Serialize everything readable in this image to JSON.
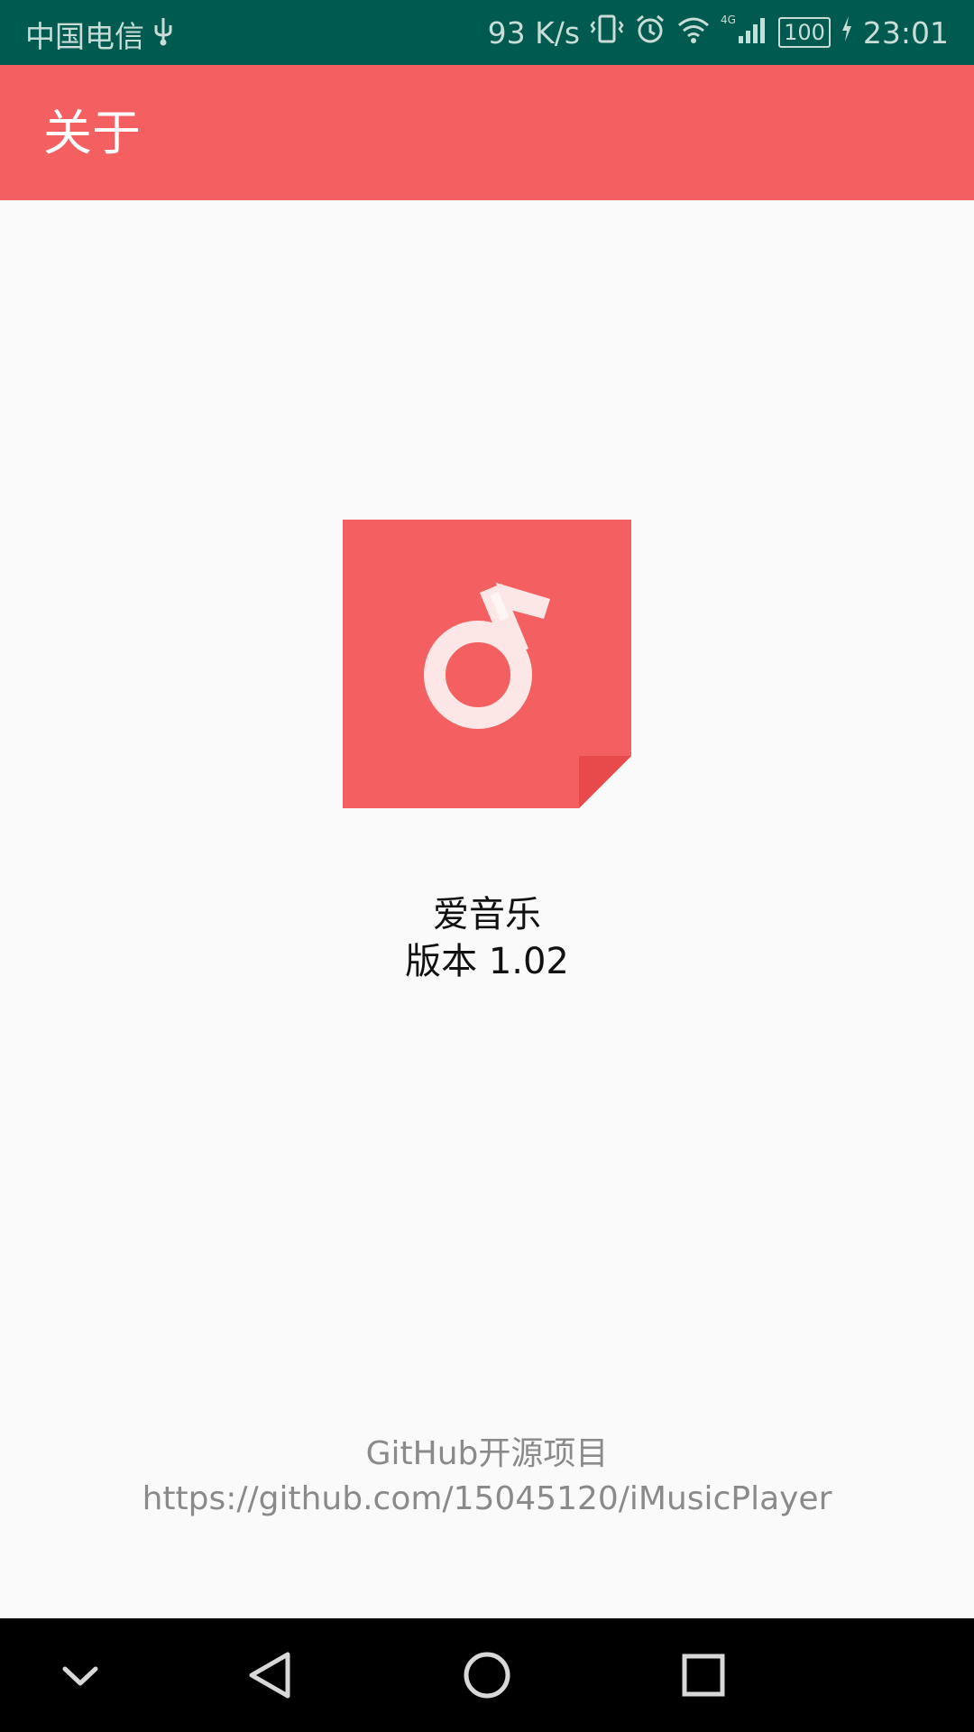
{
  "status_bar": {
    "carrier": "中国电信",
    "usb_icon": "usb-icon",
    "net_speed": "93 K/s",
    "vibrate_icon": "vibrate-icon",
    "alarm_icon": "alarm-icon",
    "wifi_icon": "wifi-icon",
    "network_type": "4G",
    "signal_icon": "signal-icon",
    "battery": "100",
    "charging_icon": "charging-icon",
    "time": "23:01"
  },
  "app_bar": {
    "title": "关于"
  },
  "about": {
    "logo_icon": "music-note-icon",
    "app_name": "爱音乐",
    "version": "版本 1.02"
  },
  "footer": {
    "title": "GitHub开源项目",
    "link": "https://github.com/15045120/iMusicPlayer"
  },
  "nav_bar": {
    "keyboard_icon": "chevron-down-icon",
    "back_icon": "back-icon",
    "home_icon": "home-icon",
    "recents_icon": "recents-icon"
  },
  "colors": {
    "status_bar": "#005a4f",
    "app_bar": "#f46061",
    "logo_fold": "#e84a4c",
    "background": "#fafafa"
  }
}
